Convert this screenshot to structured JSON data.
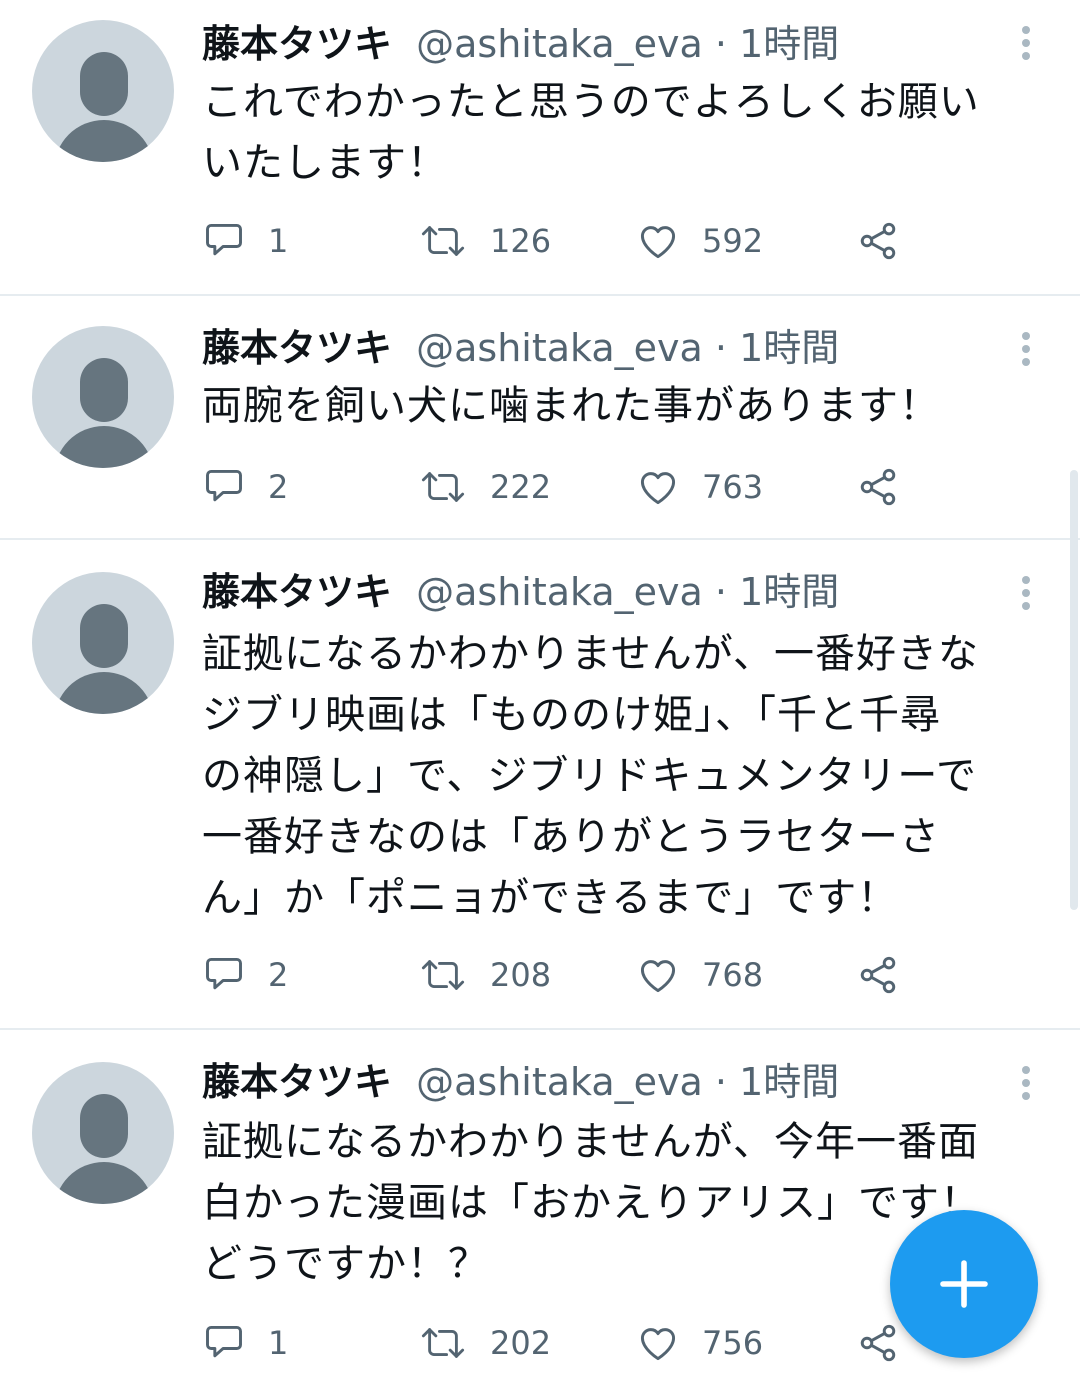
{
  "tweets": [
    {
      "name": "藤本タツキ",
      "handle": "@ashitaka_eva",
      "separator": "·",
      "time": "1時間",
      "lines": [
        "これでわかったと思うのでよろしくお願い",
        "いたします！"
      ],
      "replies": "1",
      "retweets": "126",
      "likes": "592"
    },
    {
      "name": "藤本タツキ",
      "handle": "@ashitaka_eva",
      "separator": "·",
      "time": "1時間",
      "lines": [
        "両腕を飼い犬に噛まれた事があります！"
      ],
      "replies": "2",
      "retweets": "222",
      "likes": "763"
    },
    {
      "name": "藤本タツキ",
      "handle": "@ashitaka_eva",
      "separator": "·",
      "time": "1時間",
      "lines": [
        "証拠になるかわかりませんが、一番好きな",
        "ジブリ映画は「もののけ姫」、「千と千尋",
        "の神隠し」で、ジブリドキュメンタリーで",
        "一番好きなのは「ありがとうラセターさ",
        "ん」か「ポニョができるまで」です！"
      ],
      "replies": "2",
      "retweets": "208",
      "likes": "768"
    },
    {
      "name": "藤本タツキ",
      "handle": "@ashitaka_eva",
      "separator": "·",
      "time": "1時間",
      "lines": [
        "証拠になるかわかりませんが、今年一番面",
        "白かった漫画は「おかえりアリス」です！",
        "どうですか！？"
      ],
      "replies": "1",
      "retweets": "202",
      "likes": "756"
    }
  ],
  "icons": {
    "reply": "speech-bubble-icon",
    "retweet": "retweet-arrows-icon",
    "like": "heart-outline-icon",
    "share": "share-nodes-icon",
    "more": "vertical-ellipsis-icon",
    "compose": "plus-icon"
  },
  "colors": {
    "accent": "#1d9bf0",
    "muted_text": "#536471",
    "avatar_bg": "#ccd6dd",
    "avatar_fg": "#66757f",
    "divider": "#e6ecf0"
  }
}
